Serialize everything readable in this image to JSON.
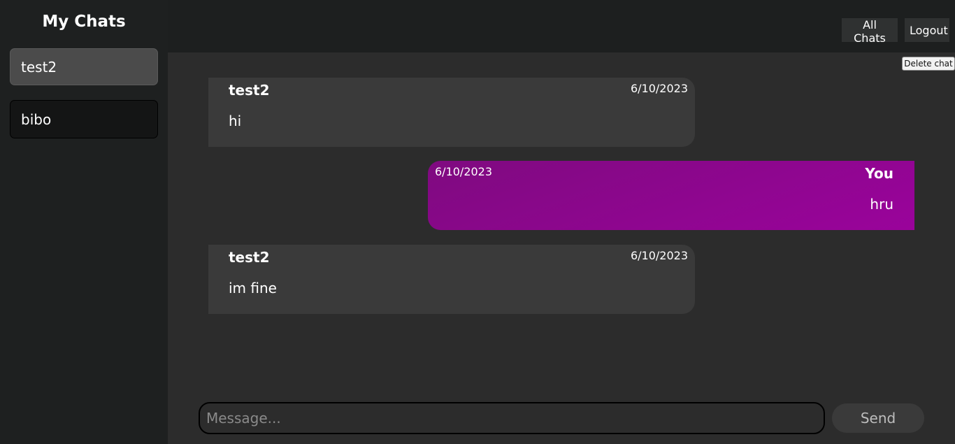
{
  "sidebar": {
    "title": "My Chats",
    "chats": [
      {
        "name": "test2",
        "active": true
      },
      {
        "name": "bibo",
        "active": false
      }
    ]
  },
  "toolbar": {
    "all_chats_label": "All Chats",
    "logout_label": "Logout",
    "delete_chat_label": "Delete chat"
  },
  "messages": [
    {
      "sender": "test2",
      "date": "6/10/2023",
      "text": "hi",
      "mine": false
    },
    {
      "sender": "You",
      "date": "6/10/2023",
      "text": "hru",
      "mine": true
    },
    {
      "sender": "test2",
      "date": "6/10/2023",
      "text": "im fine",
      "mine": false
    }
  ],
  "composer": {
    "placeholder": "Message...",
    "value": "",
    "send_label": "Send"
  },
  "colors": {
    "own_message_bubble": "#8e058f",
    "other_message_bubble": "#3a3a3a",
    "main_background": "#2c2c2c",
    "sidebar_background": "#1e2020"
  }
}
